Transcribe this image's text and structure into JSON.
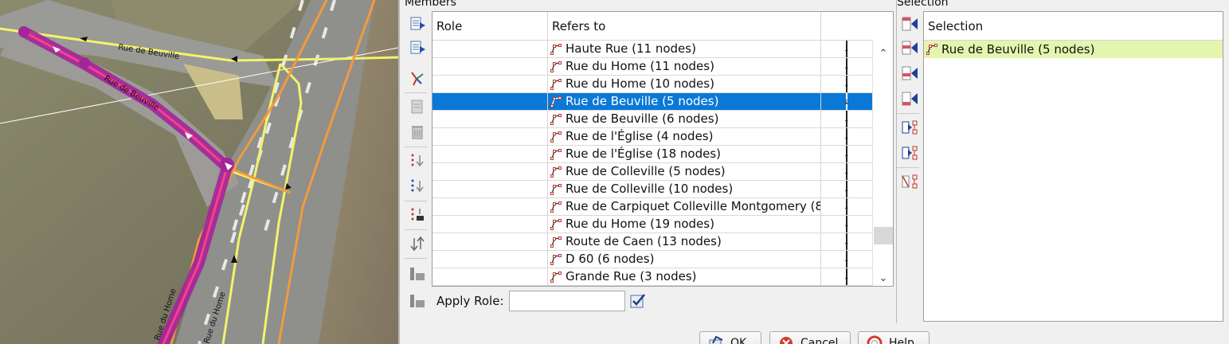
{
  "map": {
    "street_labels": [
      "Rue de Beuville",
      "Rue de Beuville",
      "Rue du Home",
      "Rue du Home"
    ]
  },
  "members": {
    "section_title": "Members",
    "columns": {
      "role": "Role",
      "refers_to": "Refers to"
    },
    "rows": [
      {
        "role": "",
        "refers_to": "Haute Rue (11 nodes)",
        "selected": false
      },
      {
        "role": "",
        "refers_to": "Rue du Home (11 nodes)",
        "selected": false
      },
      {
        "role": "",
        "refers_to": "Rue du Home (10 nodes)",
        "selected": false
      },
      {
        "role": "",
        "refers_to": "Rue de Beuville (5 nodes)",
        "selected": true
      },
      {
        "role": "",
        "refers_to": "Rue de Beuville (6 nodes)",
        "selected": false
      },
      {
        "role": "",
        "refers_to": "Rue de l'Église (4 nodes)",
        "selected": false
      },
      {
        "role": "",
        "refers_to": "Rue de l'Église (18 nodes)",
        "selected": false
      },
      {
        "role": "",
        "refers_to": "Rue de Colleville (5 nodes)",
        "selected": false
      },
      {
        "role": "",
        "refers_to": "Rue de Colleville (10 nodes)",
        "selected": false
      },
      {
        "role": "",
        "refers_to": "Rue de Carpiquet Colleville Montgomery (8…",
        "selected": false
      },
      {
        "role": "",
        "refers_to": "Rue du Home (19 nodes)",
        "selected": false
      },
      {
        "role": "",
        "refers_to": "Route de Caen (13 nodes)",
        "selected": false
      },
      {
        "role": "",
        "refers_to": "D 60 (6 nodes)",
        "selected": false
      },
      {
        "role": "",
        "refers_to": "Grande Rue (3 nodes)",
        "selected": false
      }
    ],
    "apply_role_label": "Apply Role:",
    "apply_role_value": ""
  },
  "selection": {
    "section_title": "Selection",
    "column": "Selection",
    "rows": [
      {
        "refers_to": "Rue de Beuville (5 nodes)"
      }
    ]
  },
  "buttons": {
    "ok": "OK",
    "cancel": "Cancel",
    "help": "Help"
  },
  "colors": {
    "selected_row": "#0a78d7",
    "selection_highlight": "#e4f5b0",
    "relation_highlight": "#a3259a"
  }
}
